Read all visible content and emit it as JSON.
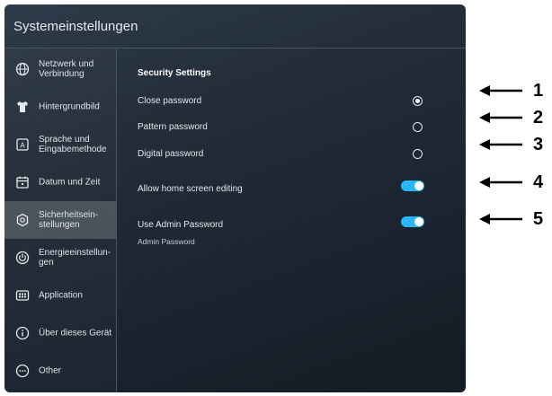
{
  "window": {
    "title": "Systemeinstellungen"
  },
  "sidebar": {
    "items": [
      {
        "label": "Netzwerk und Verbindung",
        "icon": "globe-icon"
      },
      {
        "label": "Hintergrundbild",
        "icon": "shirt-icon"
      },
      {
        "label": "Sprache und Eingabemethode",
        "icon": "keyboard-letter-icon"
      },
      {
        "label": "Datum und Zeit",
        "icon": "calendar-icon"
      },
      {
        "label": "Sicherheitsein-stellungen",
        "icon": "shield-icon",
        "active": true
      },
      {
        "label": "Energieeinstellun-gen",
        "icon": "power-icon"
      },
      {
        "label": "Application",
        "icon": "app-grid-icon"
      },
      {
        "label": "Über dieses Gerät",
        "icon": "info-icon"
      },
      {
        "label": "Other",
        "icon": "more-icon"
      }
    ]
  },
  "security": {
    "title": "Security Settings",
    "close_password": "Close password",
    "pattern_password": "Pattern password",
    "digital_password": "Digital password",
    "selected": "Close password",
    "allow_home_editing": "Allow home screen editing",
    "allow_home_editing_on": true,
    "use_admin_password": "Use Admin Password",
    "use_admin_password_on": true,
    "admin_password_label": "Admin Password"
  },
  "annotations": [
    "1",
    "2",
    "3",
    "4",
    "5"
  ],
  "colors": {
    "toggle_on": "#29b6f6",
    "active_item": "rgba(255,255,255,0.18)"
  }
}
